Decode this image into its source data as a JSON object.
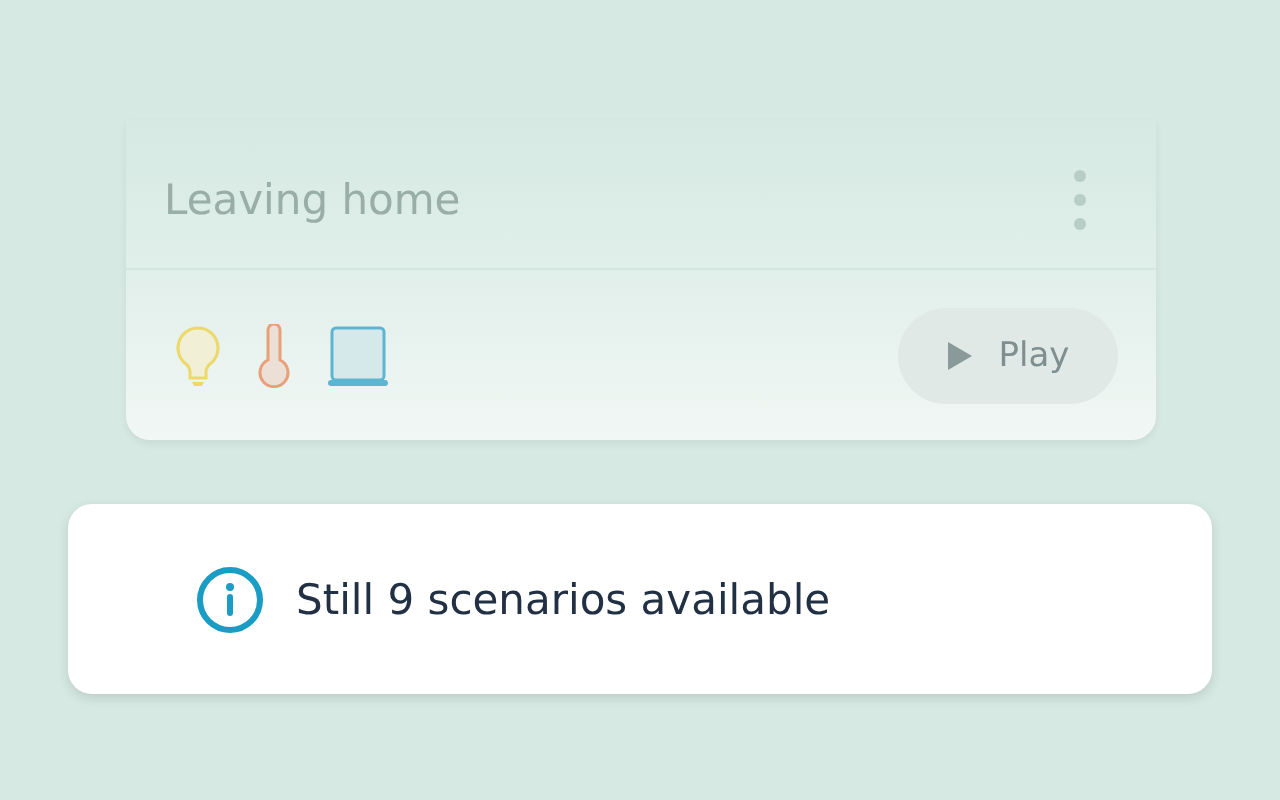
{
  "scenario_card": {
    "title": "Leaving home",
    "play_button": "Play"
  },
  "toast": {
    "message": "Still 9 scenarios available"
  }
}
